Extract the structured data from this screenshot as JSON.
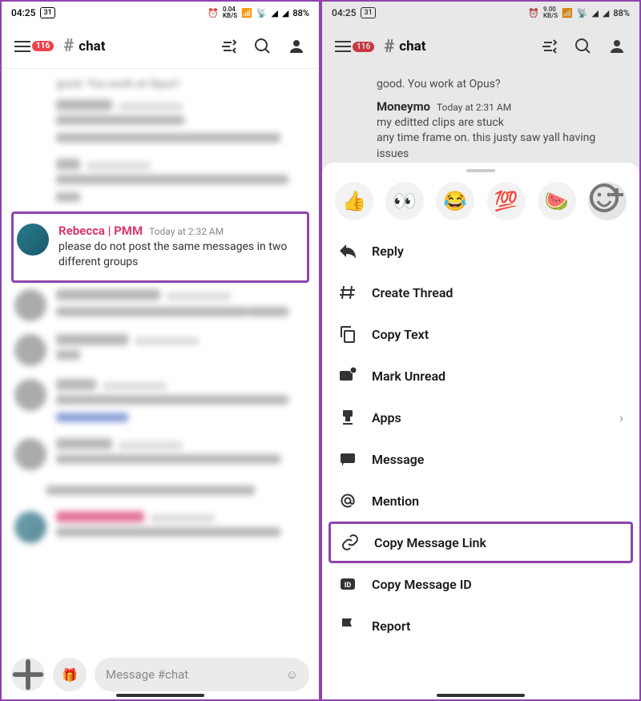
{
  "status": {
    "time": "04:25",
    "date": "31",
    "kbps_left": "0.04",
    "kbps_right": "9.00",
    "kbps_unit": "KB/S",
    "battery": "88%"
  },
  "header": {
    "badge": "116",
    "channel": "chat",
    "hash": "#"
  },
  "left": {
    "highlighted_msg": {
      "author": "Rebecca | PMM",
      "timestamp": "Today at 2:32 AM",
      "text": "please do not post the same messages in two different groups"
    },
    "top_text": "good. You work at Opus?",
    "composer_placeholder": "Message #chat"
  },
  "right": {
    "top_text": "good. You work at Opus?",
    "msg": {
      "author": "Moneymo",
      "timestamp": "Today at 2:31 AM",
      "line1": "my editted clips are stuck",
      "line2": "any time frame on. this justy saw yall having issues"
    },
    "reactions": [
      "👍",
      "👀",
      "😂",
      "💯",
      "🍉"
    ],
    "menu": [
      {
        "label": "Reply",
        "icon": "reply"
      },
      {
        "label": "Create Thread",
        "icon": "thread"
      },
      {
        "label": "Copy Text",
        "icon": "copy"
      },
      {
        "label": "Mark Unread",
        "icon": "unread"
      },
      {
        "label": "Apps",
        "icon": "apps",
        "chevron": true
      },
      {
        "label": "Message",
        "icon": "message"
      },
      {
        "label": "Mention",
        "icon": "mention"
      },
      {
        "label": "Copy Message Link",
        "icon": "link",
        "highlighted": true
      },
      {
        "label": "Copy Message ID",
        "icon": "id"
      },
      {
        "label": "Report",
        "icon": "flag"
      }
    ]
  }
}
